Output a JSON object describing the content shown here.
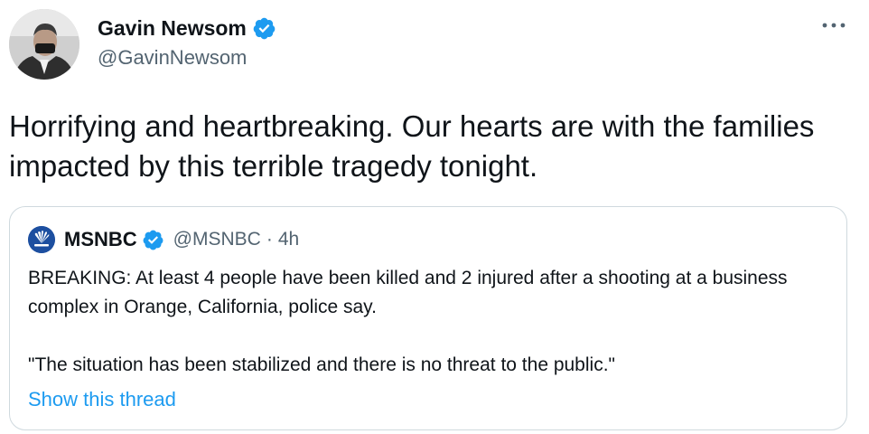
{
  "author": {
    "name": "Gavin Newsom",
    "handle": "@GavinNewsom",
    "verified": true,
    "avatar_icon": "profile-photo"
  },
  "more_icon": "more-horizontal-icon",
  "tweet": {
    "text": "Horrifying and heartbreaking. Our hearts are with the families impacted by this terrible tragedy tonight."
  },
  "quoted_tweet": {
    "name": "MSNBC",
    "handle": "@MSNBC",
    "separator": "·",
    "time": "4h",
    "verified": true,
    "avatar_icon": "msnbc-peacock-logo",
    "paragraph1": "BREAKING: At least 4 people have been killed and 2 injured after a shooting at a business complex in Orange, California, police say.",
    "paragraph2": "\"The situation has been stabilized and there is no threat to the public.\"",
    "show_thread": "Show this thread"
  },
  "colors": {
    "text": "#0f1419",
    "secondary": "#536471",
    "link": "#1d9bf0",
    "verified": "#1d9bf0",
    "border": "#cfd9de"
  }
}
